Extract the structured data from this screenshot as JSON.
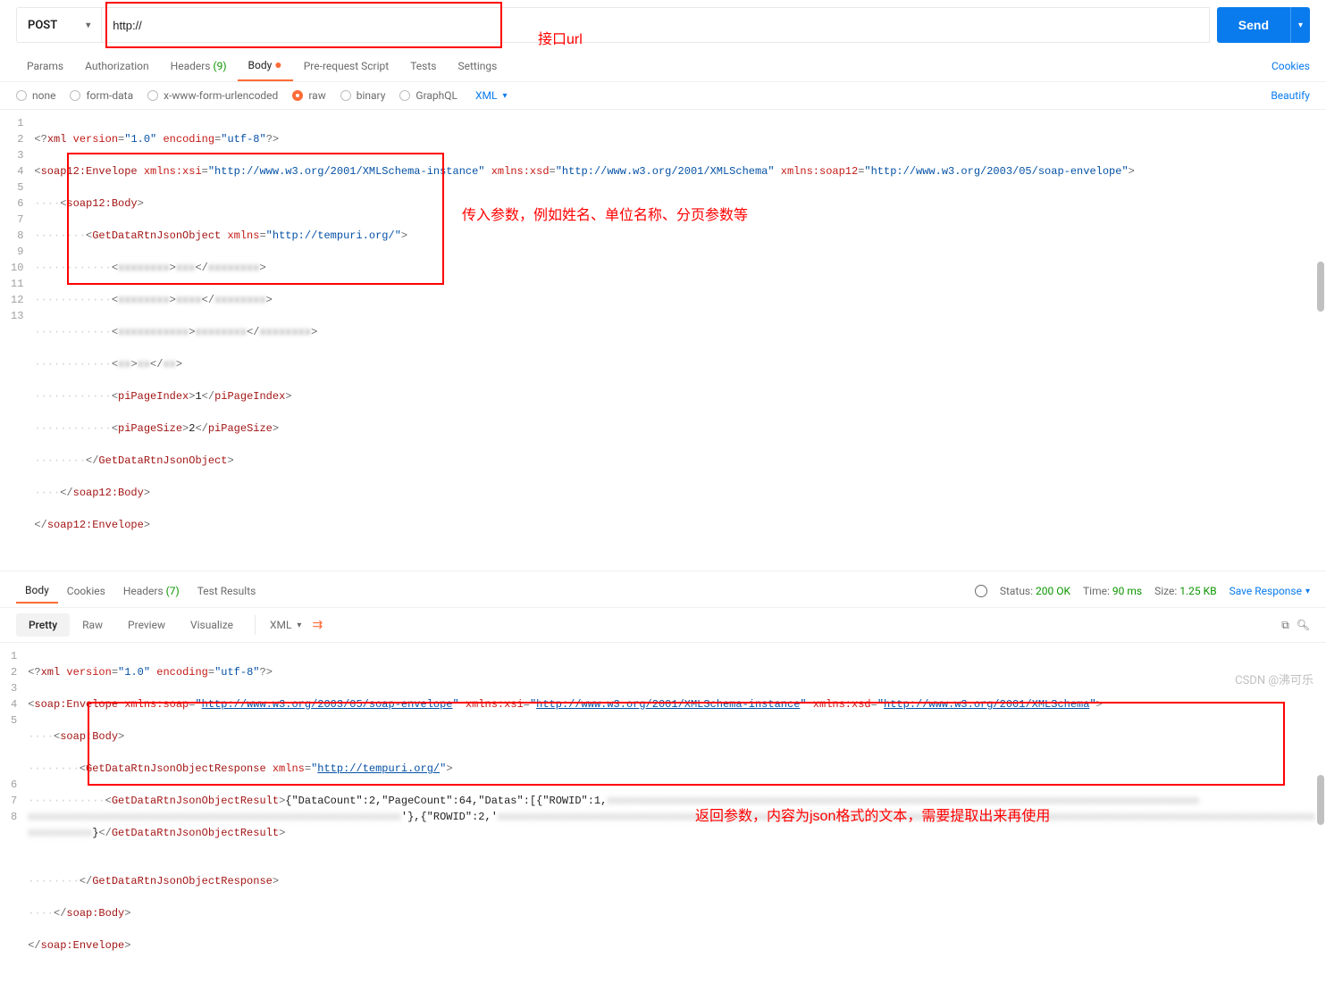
{
  "request": {
    "method": "POST",
    "url": "http://",
    "send_label": "Send"
  },
  "tabs": {
    "items": [
      {
        "label": "Params"
      },
      {
        "label": "Authorization"
      },
      {
        "label": "Headers",
        "count": "(9)"
      },
      {
        "label": "Body",
        "active": true,
        "dot": "●"
      },
      {
        "label": "Pre-request Script"
      },
      {
        "label": "Tests"
      },
      {
        "label": "Settings"
      }
    ],
    "cookies": "Cookies"
  },
  "body_types": {
    "options": [
      "none",
      "form-data",
      "x-www-form-urlencoded",
      "raw",
      "binary",
      "GraphQL"
    ],
    "selected": "raw",
    "format": "XML",
    "beautify": "Beautify"
  },
  "request_code_plain": "<?xml version=\"1.0\" encoding=\"utf-8\"?>\n<soap12:Envelope xmlns:xsi=\"http://www.w3.org/2001/XMLSchema-instance\" xmlns:xsd=\"http://www.w3.org/2001/XMLSchema\" xmlns:soap12=\"http://www.w3.org/2003/05/soap-envelope\">\n  <soap12:Body>\n    <GetDataRtnJsonObject xmlns=\"http://tempuri.org/\">\n      <            >    </            >\n      <            >    </            >\n      <            >       </            >\n      <  >  </  >\n      <piPageIndex>1</piPageIndex>\n      <piPageSize>2</piPageSize>\n    </GetDataRtnJsonObject>\n  </soap12:Body>\n</soap12:Envelope>",
  "response_header": {
    "tabs": [
      "Body",
      "Cookies",
      "Headers",
      "Test Results"
    ],
    "headers_count": "(7)",
    "status_label": "Status:",
    "status_val": "200 OK",
    "time_label": "Time:",
    "time_val": "90 ms",
    "size_label": "Size:",
    "size_val": "1.25 KB",
    "save": "Save Response"
  },
  "viewmode": {
    "tabs": [
      "Pretty",
      "Raw",
      "Preview",
      "Visualize"
    ],
    "format": "XML"
  },
  "response_code_plain": "<?xml version=\"1.0\" encoding=\"utf-8\"?>\n<soap:Envelope xmlns:soap=\"http://www.w3.org/2003/05/soap-envelope\" xmlns:xsi=\"http://www.w3.org/2001/XMLSchema-instance\" xmlns:xsd=\"http://www.w3.org/2001/XMLSchema\">\n  <soap:Body>\n    <GetDataRtnJsonObjectResponse xmlns=\"http://tempuri.org/\">\n      <GetDataRtnJsonObjectResult>{\"DataCount\":2,\"PageCount\":64,\"Datas\":[{\"ROWID\":1,\n                                                    '},{\"ROWID\":2,'\n                        }</GetDataRtnJsonObjectResult>\n    </GetDataRtnJsonObjectResponse>\n  </soap:Body>\n</soap:Envelope>",
  "annotations": {
    "url_label": "接口url",
    "params_label": "传入参数，例如姓名、单位名称、分页参数等",
    "return_label": "返回参数，内容为json格式的文本，需要提取出来再使用"
  },
  "watermark": "CSDN @沸可乐"
}
